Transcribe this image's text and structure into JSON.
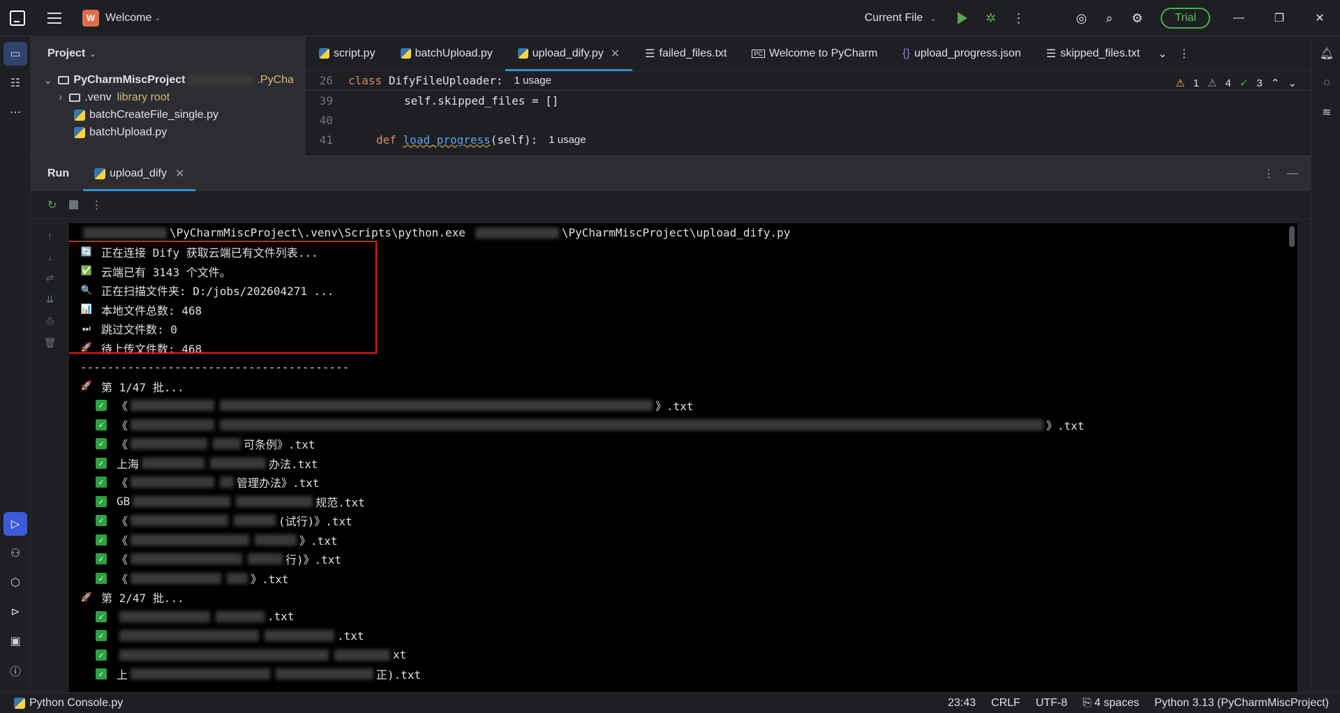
{
  "titlebar": {
    "project_badge": "W",
    "project_name": "Welcome",
    "run_config": "Current File",
    "trial_label": "Trial"
  },
  "project_panel": {
    "header": "Project",
    "root_name": "PyCharmMiscProject",
    "root_suffix": ".PyCha",
    "items": [
      {
        "name": ".venv",
        "note": "library root"
      },
      {
        "name": "batchCreateFile_single.py",
        "note": ""
      },
      {
        "name": "batchUpload.py",
        "note": ""
      }
    ]
  },
  "editor": {
    "tabs": [
      {
        "label": "script.py"
      },
      {
        "label": "batchUpload.py"
      },
      {
        "label": "upload_dify.py"
      },
      {
        "label": "failed_files.txt"
      },
      {
        "label": "Welcome to PyCharm"
      },
      {
        "label": "upload_progress.json"
      },
      {
        "label": "skipped_files.txt"
      }
    ],
    "inspections": {
      "warnings": "1",
      "weak": "4",
      "ok": "3"
    },
    "lines": [
      {
        "num": "26",
        "kw": "class",
        "name": "DifyFileUploader:",
        "hint": "1 usage"
      },
      {
        "num": "39",
        "text": "self.skipped_files = []"
      },
      {
        "num": "40",
        "text": ""
      },
      {
        "num": "41",
        "kw": "def",
        "name": "load_progress",
        "args": "(self):",
        "hint": "1 usage"
      }
    ]
  },
  "run_panel": {
    "title": "Run",
    "tab_label": "upload_dify",
    "command_mid": "\\PyCharmMiscProject\\.venv\\Scripts\\python.exe",
    "command_end": "\\PyCharmMiscProject\\upload_dify.py",
    "highlight_lines": [
      {
        "icon": "🔄",
        "text": "正在连接 Dify 获取云端已有文件列表..."
      },
      {
        "icon": "✅",
        "text": "云端已有 3143 个文件。"
      },
      {
        "icon": "🔍",
        "text": "正在扫描文件夹: D:/jobs/202604271 ..."
      },
      {
        "icon": "📊",
        "text": "本地文件总数: 468"
      },
      {
        "icon": "⏭",
        "text": "跳过文件数: 0"
      },
      {
        "icon": "🚀",
        "text": "待上传文件数: 468"
      }
    ],
    "separator": "----------------------------------------",
    "batch1_label": "第 1/47 批...",
    "batch1_files": [
      {
        "pre": "《",
        "post": "》.txt",
        "w1": 120,
        "w2": 620
      },
      {
        "pre": "《",
        "post": "》.txt",
        "w1": 120,
        "w2": 1180
      },
      {
        "pre": "《",
        "post": "可条例》.txt",
        "w1": 110,
        "w2": 40
      },
      {
        "pre": "上海",
        "post": "办法.txt",
        "w1": 90,
        "w2": 80
      },
      {
        "pre": "《",
        "post": "管理办法》.txt",
        "w1": 120,
        "w2": 20
      },
      {
        "pre": "GB",
        "post": "规范.txt",
        "w1": 140,
        "w2": 110
      },
      {
        "pre": "《",
        "post": "(试行)》.txt",
        "w1": 140,
        "w2": 60
      },
      {
        "pre": "《",
        "post": "》.txt",
        "w1": 170,
        "w2": 60
      },
      {
        "pre": "《",
        "post": "行)》.txt",
        "w1": 160,
        "w2": 50
      },
      {
        "pre": "《",
        "post": "》.txt",
        "w1": 130,
        "w2": 30
      }
    ],
    "batch2_label": "第 2/47 批...",
    "batch2_files": [
      {
        "pre": "",
        "post": ".txt",
        "w1": 130,
        "w2": 70
      },
      {
        "pre": "",
        "post": ".txt",
        "w1": 200,
        "w2": 100
      },
      {
        "pre": "",
        "post": "xt",
        "w1": 300,
        "w2": 80
      },
      {
        "pre": "上",
        "post": "正).txt",
        "w1": 200,
        "w2": 140
      }
    ]
  },
  "statusbar": {
    "left": "Python Console.py",
    "position": "23:43",
    "line_sep": "CRLF",
    "encoding": "UTF-8",
    "indent": "4 spaces",
    "interpreter": "Python 3.13 (PyCharmMiscProject)"
  }
}
